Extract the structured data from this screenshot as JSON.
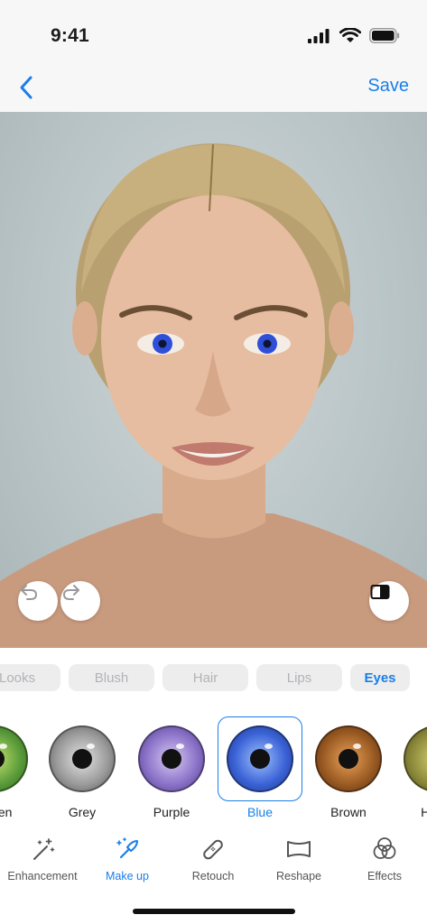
{
  "status_bar": {
    "time": "9:41",
    "icons": [
      "signal-icon",
      "wifi-icon",
      "battery-icon"
    ]
  },
  "nav": {
    "back_icon": "chevron-left-icon",
    "save_label": "Save"
  },
  "photo": {
    "alt": "Portrait with blue eyes applied",
    "controls": [
      "undo-icon",
      "redo-icon",
      "compare-icon"
    ]
  },
  "categories": [
    {
      "label": "Looks",
      "active": false
    },
    {
      "label": "Blush",
      "active": false
    },
    {
      "label": "Hair",
      "active": false
    },
    {
      "label": "Lips",
      "active": false
    },
    {
      "label": "Eyes",
      "active": true
    }
  ],
  "eye_colors": [
    {
      "label": "Green",
      "color": "#5a9c3a",
      "selected": false
    },
    {
      "label": "Grey",
      "color": "#9a9a9a",
      "selected": false
    },
    {
      "label": "Purple",
      "color": "#8a72c8",
      "selected": false
    },
    {
      "label": "Blue",
      "color": "#3a62d6",
      "selected": true
    },
    {
      "label": "Brown",
      "color": "#9a5a22",
      "selected": false
    },
    {
      "label": "Hazel",
      "color": "#8c8a3a",
      "selected": false
    }
  ],
  "toolbar": [
    {
      "label": "Enhancement",
      "icon": "magic-wand-icon",
      "active": false
    },
    {
      "label": "Make up",
      "icon": "makeup-brush-icon",
      "active": true
    },
    {
      "label": "Retouch",
      "icon": "bandage-icon",
      "active": false
    },
    {
      "label": "Reshape",
      "icon": "reshape-icon",
      "active": false
    },
    {
      "label": "Effects",
      "icon": "effects-circles-icon",
      "active": false
    }
  ],
  "colors": {
    "accent": "#1a7fe8",
    "chip_bg": "#ededee",
    "chip_text": "#b3b3b7"
  }
}
